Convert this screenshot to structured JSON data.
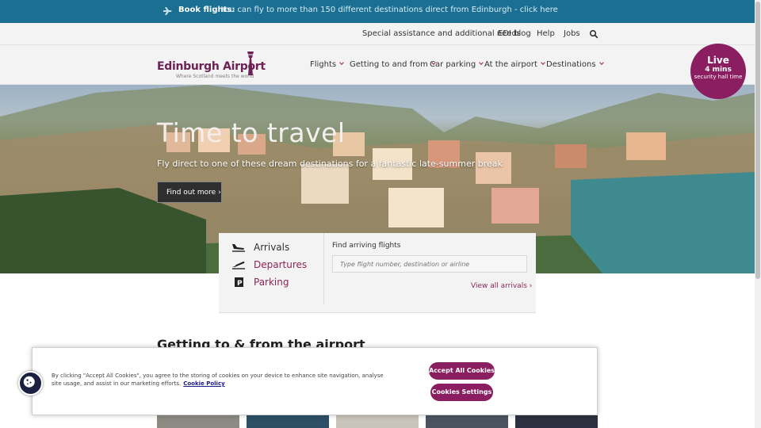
{
  "banner": {
    "label": "Book flights:",
    "text": "You can fly to more than 150 different destinations direct from Edinburgh - click here"
  },
  "utility_nav": {
    "items": [
      "Special assistance and additional needs",
      "EDI blog",
      "Help",
      "Jobs"
    ]
  },
  "logo": {
    "name": "Edinburgh Airport",
    "tagline": "Where Scotland meets the world"
  },
  "main_nav": {
    "items": [
      "Flights",
      "Getting to and from",
      "Car parking",
      "At the airport",
      "Destinations"
    ]
  },
  "hero": {
    "title": "Time to travel",
    "subtitle": "Fly direct to one of these dream destinations for a fantastic late-summer break",
    "button": "Find out more"
  },
  "live_badge": {
    "title": "Live",
    "value": "4 mins",
    "caption": "security hall time"
  },
  "flight_panel": {
    "tabs": [
      "Arrivals",
      "Departures",
      "Parking"
    ],
    "find_label": "Find arriving flights",
    "search_placeholder": "Type flight number, destination or airline",
    "view_all": "View all arrivals"
  },
  "section_heading": "Getting to & from the airport",
  "cookie": {
    "text": "By clicking \"Accept All Cookies\", you agree to the storing of cookies on your device to enhance site navigation, analyse site usage, and assist in our marketing efforts.",
    "policy_link": "Cookie Policy",
    "accept_button": "Accept All Cookies",
    "settings_button": "Cookies Settings"
  },
  "colors": {
    "banner": "#1b6f93",
    "brand_purple": "#8a1e60"
  }
}
